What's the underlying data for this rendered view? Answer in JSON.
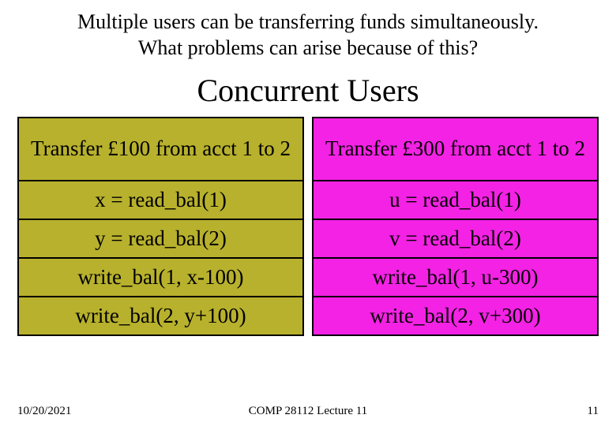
{
  "lead_line1": "Multiple users can be transferring funds simultaneously.",
  "lead_line2": "What problems can arise because of this?",
  "title": "Concurrent Users",
  "left": {
    "header": "Transfer £100 from acct 1 to 2",
    "rows": [
      "x = read_bal(1)",
      "y = read_bal(2)",
      "write_bal(1, x-100)",
      "write_bal(2, y+100)"
    ]
  },
  "right": {
    "header": "Transfer £300 from acct 1 to 2",
    "rows": [
      "u = read_bal(1)",
      "v = read_bal(2)",
      "write_bal(1, u-300)",
      "write_bal(2, v+300)"
    ]
  },
  "footer": {
    "date": "10/20/2021",
    "course": "COMP 28112 Lecture 11",
    "page": "11"
  }
}
